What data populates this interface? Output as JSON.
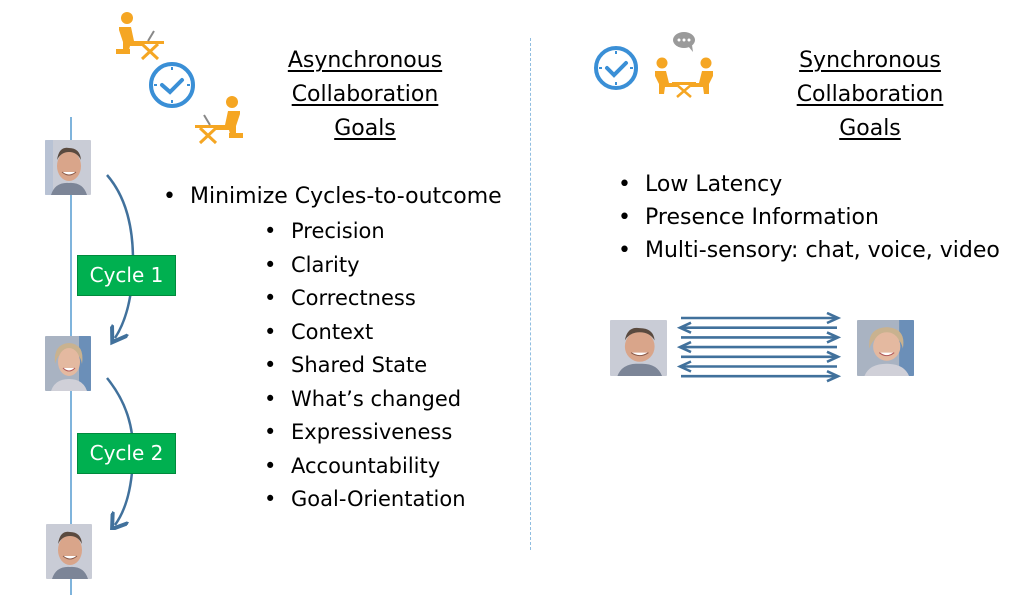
{
  "async_section": {
    "heading_lines": [
      "Asynchronous",
      "Collaboration",
      "Goals"
    ],
    "icons": [
      "person-at-laptop-icon",
      "clock-icon",
      "person-at-laptop-icon"
    ],
    "main_bullets": [
      "Minimize Cycles-to-outcome"
    ],
    "sub_bullets": [
      "Precision",
      "Clarity",
      "Correctness",
      "Context",
      "Shared State",
      "What’s changed",
      "Expressiveness",
      "Accountability",
      "Goal-Orientation"
    ],
    "timeline": {
      "participants": [
        "man-avatar",
        "woman-avatar",
        "man-avatar"
      ],
      "cycles": [
        "Cycle 1",
        "Cycle 2"
      ]
    }
  },
  "sync_section": {
    "heading_lines": [
      "Synchronous",
      "Collaboration",
      "Goals"
    ],
    "icons": [
      "clock-icon",
      "two-people-meeting-icon",
      "chat-bubble-icon"
    ],
    "bullets": [
      "Low Latency",
      "Presence Information",
      "Multi-sensory: chat, voice, video"
    ],
    "exchange": {
      "left_participant": "man-avatar",
      "right_participant": "woman-avatar",
      "arrow_directions": [
        "right",
        "left",
        "right",
        "left",
        "right",
        "left",
        "right"
      ]
    }
  },
  "colors": {
    "cycle_label_bg": "#00b050",
    "arrow": "#41719c",
    "icon_orange": "#f5a623",
    "icon_blue": "#3a8fd6",
    "divider": "#8fbde0"
  }
}
